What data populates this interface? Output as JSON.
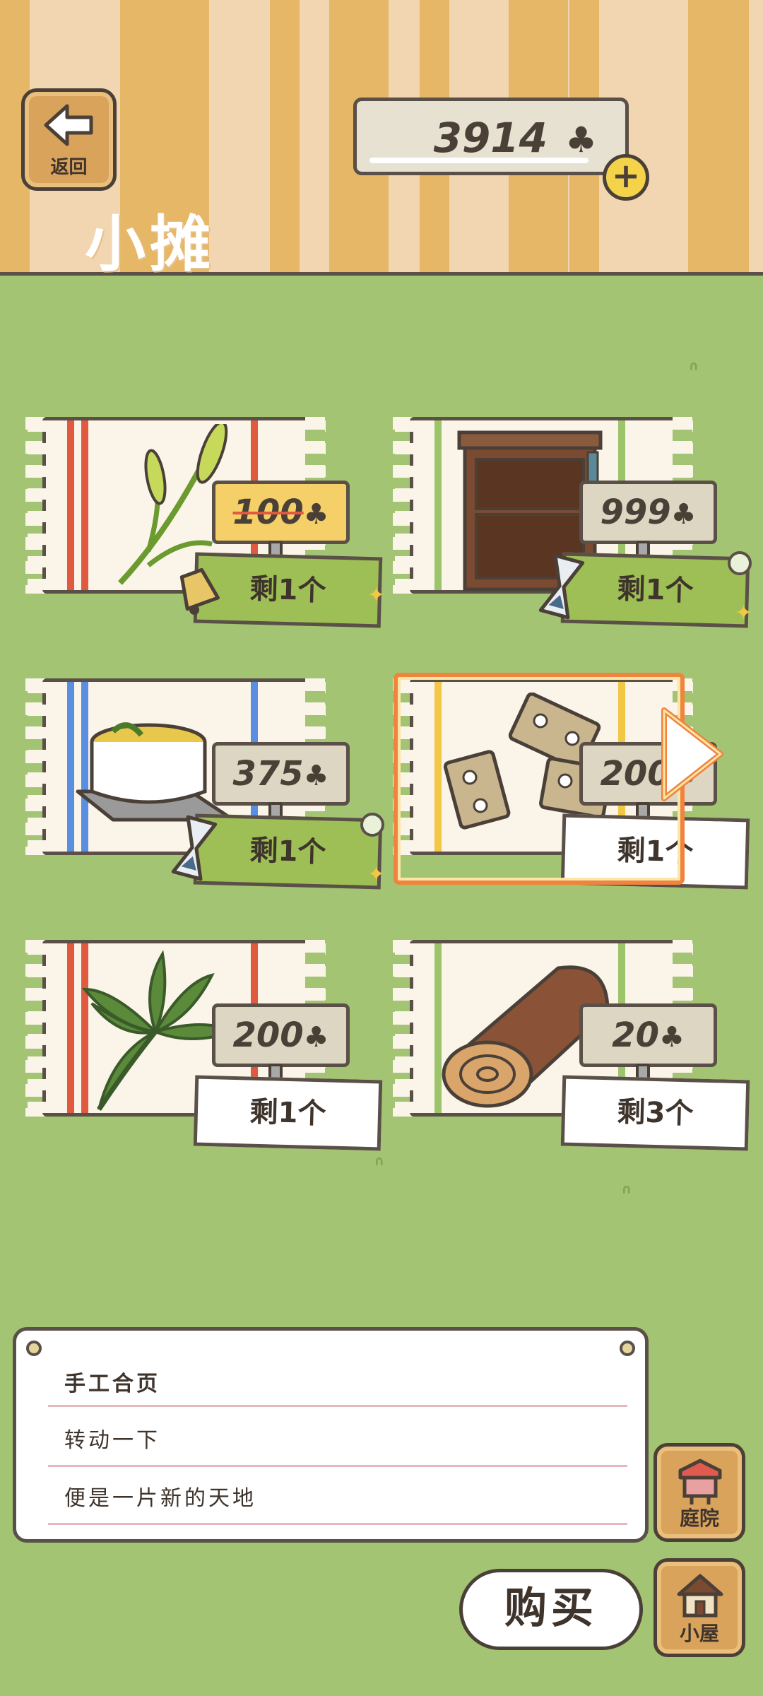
{
  "header": {
    "back_label": "返回",
    "shop_title": "小摊",
    "currency_value": "3914",
    "currency_icon": "clover-icon"
  },
  "items": [
    {
      "name": "plant-stalk",
      "price": "100",
      "stock": "剩1个",
      "sale": true,
      "stock_style": "green",
      "badge": "bell-icon"
    },
    {
      "name": "wooden-cabinet",
      "price": "999",
      "stock": "剩1个",
      "sale": false,
      "stock_style": "green",
      "badge": "hourglass-icon"
    },
    {
      "name": "hot-pot",
      "price": "375",
      "stock": "剩1个",
      "sale": false,
      "stock_style": "green",
      "badge": "hourglass-icon"
    },
    {
      "name": "hinges",
      "price": "200",
      "stock": "剩1个",
      "sale": false,
      "stock_style": "white",
      "selected": true
    },
    {
      "name": "palm-leaf",
      "price": "200",
      "stock": "剩1个",
      "sale": false,
      "stock_style": "white"
    },
    {
      "name": "log",
      "price": "20",
      "stock": "剩3个",
      "sale": false,
      "stock_style": "white"
    }
  ],
  "description": {
    "line1": "手工合页",
    "line2": "转动一下",
    "line3": "便是一片新的天地"
  },
  "actions": {
    "buy_label": "购买",
    "yard_label": "庭院",
    "house_label": "小屋"
  },
  "colors": {
    "grass": "#a3c472",
    "highlight": "#f0843e",
    "sale_tag": "#f5cf68",
    "stock_green": "#9ebf55"
  }
}
